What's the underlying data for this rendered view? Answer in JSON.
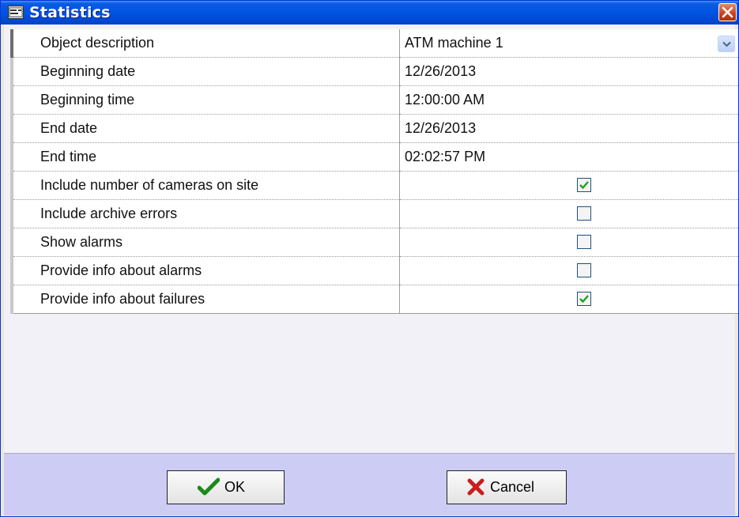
{
  "window": {
    "title": "Statistics"
  },
  "properties": [
    {
      "label": "Object description",
      "value": "ATM machine 1",
      "type": "dropdown"
    },
    {
      "label": "Beginning date",
      "value": "12/26/2013",
      "type": "text"
    },
    {
      "label": "Beginning time",
      "value": "12:00:00 AM",
      "type": "text"
    },
    {
      "label": "End date",
      "value": "12/26/2013",
      "type": "text"
    },
    {
      "label": "End time",
      "value": "02:02:57 PM",
      "type": "text"
    },
    {
      "label": "Include number of cameras on site",
      "checked": true,
      "type": "checkbox"
    },
    {
      "label": "Include archive errors",
      "checked": false,
      "type": "checkbox"
    },
    {
      "label": "Show alarms",
      "checked": false,
      "type": "checkbox"
    },
    {
      "label": "Provide info about alarms",
      "checked": false,
      "type": "checkbox"
    },
    {
      "label": "Provide info about failures",
      "checked": true,
      "type": "checkbox"
    }
  ],
  "buttons": {
    "ok_label": "OK",
    "cancel_label": "Cancel"
  },
  "colors": {
    "titlebar": "#0054e3",
    "check": "#21a121",
    "ok_icon": "#1a8a1a",
    "cancel_icon": "#c81e1e",
    "footer": "#ccccf4"
  },
  "icons": {
    "title": "window-icon",
    "close": "close-icon",
    "dropdown": "chevron-down-icon",
    "ok": "checkmark-icon",
    "cancel": "x-icon"
  }
}
